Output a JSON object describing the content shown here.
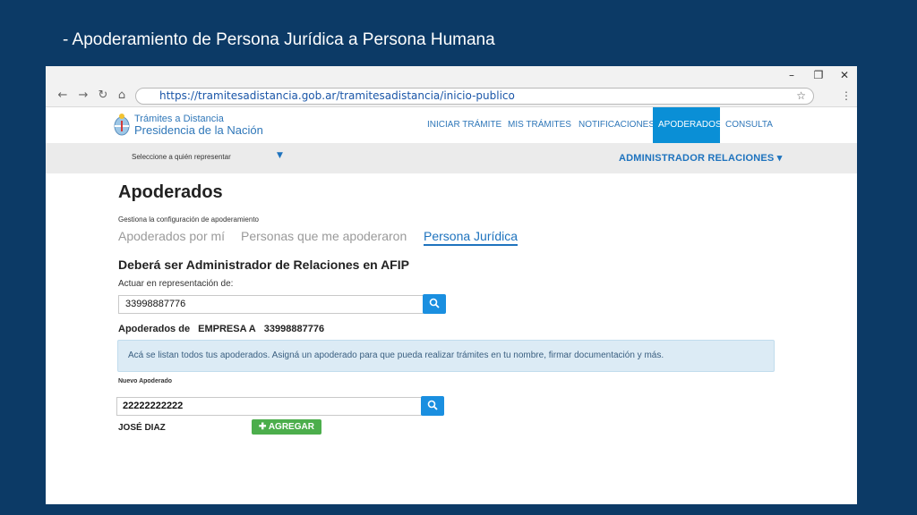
{
  "slide": {
    "title": "- Apoderamiento de Persona Jurídica a Persona Humana"
  },
  "window": {
    "minimize": "–",
    "restore": "❐",
    "close": "✕"
  },
  "browser": {
    "back": "←",
    "forward": "→",
    "reload": "↻",
    "home": "⌂",
    "url": "https://tramitesadistancia.gob.ar/tramitesadistancia/inicio-publico",
    "bookmark": "☆",
    "menu": "⋮"
  },
  "header": {
    "brand_line1": "Trámites a Distancia",
    "brand_line2": "Presidencia de la Nación",
    "nav": [
      {
        "label": "INICIAR TRÁMITE",
        "active": false
      },
      {
        "label": "MIS TRÁMITES",
        "active": false
      },
      {
        "label": "NOTIFICACIONES",
        "active": false
      },
      {
        "label": "APODERADOS",
        "active": true
      },
      {
        "label": "CONSULTA",
        "active": false
      }
    ]
  },
  "subbar": {
    "selector_label": "Seleccione a quién representar",
    "selector_caret": "▼",
    "admin_menu": "ADMINISTRADOR RELACIONES ▾"
  },
  "main": {
    "title": "Apoderados",
    "subtitle": "Gestiona la configuración de apoderamiento",
    "tabs": [
      {
        "label": "Apoderados por mí",
        "active": false
      },
      {
        "label": "Personas que me apoderaron",
        "active": false
      },
      {
        "label": "Persona Jurídica",
        "active": true
      }
    ],
    "section_heading": "Deberá ser Administrador de Relaciones en AFIP",
    "represent_label": "Actuar en representación de:",
    "represent_value": "33998887776",
    "apoderados_de_label": "Apoderados de",
    "company_name": "EMPRESA A",
    "company_cuit": "33998887776",
    "info_text": "Acá se listan todos tus apoderados. Asigná un apoderado para que pueda realizar trámites en tu nombre, firmar documentación y más.",
    "nuevo_label": "Nuevo Apoderado",
    "nuevo_value": "22222222222",
    "result_name": "JOSÉ DIAZ",
    "add_button": "✚ AGREGAR",
    "search_icon_glyph": "🔍"
  },
  "colors": {
    "slide_bg": "#0c3a66",
    "accent": "#1e73be",
    "nav_active": "#0a8fd6",
    "search_button": "#1a8fe0",
    "add_button": "#4cae4c",
    "info_bg": "#dcebf5"
  }
}
